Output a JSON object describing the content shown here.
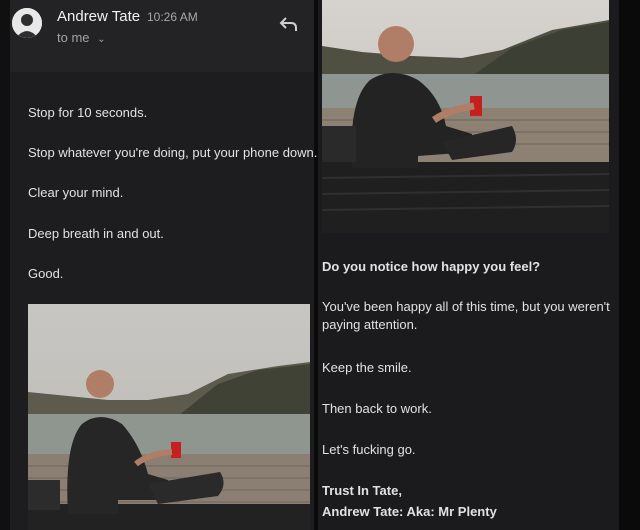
{
  "email": {
    "sender_name": "Andrew Tate",
    "time": "10:26 AM",
    "recipient_label": "to me"
  },
  "icons": {
    "avatar": "avatar-icon",
    "chevron": "chevron-down-icon",
    "reply": "reply-icon"
  },
  "body_left": [
    "Stop for 10 seconds.",
    "Stop whatever you're doing, put your phone down.",
    "Clear your mind.",
    "Deep breath in and out.",
    "Good."
  ],
  "body_right": {
    "question": "Do you notice how happy you feel?",
    "line_1": "You've been happy all of this time, but you weren't paying attention.",
    "line_2": "Keep the smile.",
    "line_3": "Then back to work.",
    "line_4": "Let's fucking go.",
    "signature_1": "Trust In Tate,",
    "signature_2": "Andrew Tate: Aka: Mr Plenty"
  },
  "colors": {
    "background": "#101010",
    "panel": "#1d1d1f",
    "text": "#e2e2e2",
    "muted": "#a8a8a8"
  }
}
